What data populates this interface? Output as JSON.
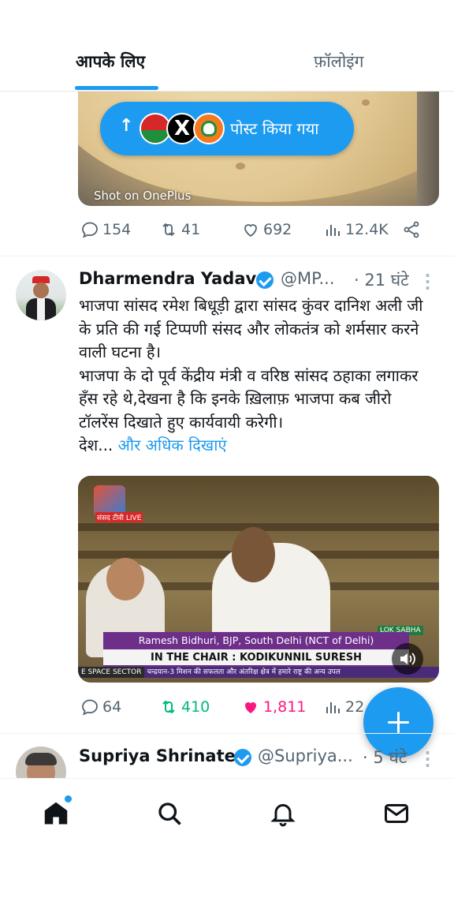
{
  "tabs": {
    "for_you": "आपके लिए",
    "following": "फ़ॉलोइंग"
  },
  "tweet1": {
    "media_caption": "Shot on OnePlus",
    "posted_pill": {
      "arrow": "↑",
      "label": "पोस्ट किया गया",
      "x_logo": "X"
    },
    "stats": {
      "replies": "154",
      "reposts": "41",
      "likes": "692",
      "views": "12.4K"
    }
  },
  "tweet2": {
    "name": "Dharmendra Yadav",
    "handle": "@MP...",
    "time": "· 21 घंटे",
    "text_p1": "भाजपा सांसद रमेश बिधूड़ी द्वारा सांसद कुंवर दानिश अली जी के प्रति की गई टिप्पणी संसद और लोकतंत्र को शर्मसार करने वाली घटना है।",
    "text_p2": "भाजपा के दो पूर्व केंद्रीय मंत्री व वरिष्ठ सांसद ठहाका लगाकर हँस रहे थे,देखना है कि इनके ख़िलाफ़ भाजपा कब जीरो टॉलरेंस दिखाते हुए कार्यवायी करेगी।",
    "text_p3_start": "देश...",
    "show_more": "और अधिक दिखाएं",
    "video": {
      "banner_line1": "Ramesh Bidhuri, BJP, South Delhi (NCT of Delhi)",
      "banner_line2": "IN THE CHAIR : KODIKUNNIL SURESH",
      "ticker_left": "E SPACE SECTOR",
      "ticker_text": "चन्द्रयान-3 मिशन की सफलता और अंतरिक्ष क्षेत्र में हमारे राष्ट्र की अन्य उपल",
      "channel_tag": "संसद टीवी LIVE",
      "lok_sabha_tag": "LOK SABHA"
    },
    "stats": {
      "replies": "64",
      "reposts": "410",
      "likes": "1,811",
      "views": "22"
    }
  },
  "tweet3": {
    "name": "Supriya Shrinate",
    "handle": "@Supriya...",
    "time": "· 5 घंटे"
  },
  "colors": {
    "accent": "#1d9bf0",
    "repost_active": "#00ba7c",
    "like_active": "#f91880",
    "muted_text": "#536471"
  },
  "icons": [
    "reply-icon",
    "repost-icon",
    "like-icon",
    "views-icon",
    "share-icon",
    "verified-icon",
    "more-icon",
    "home-icon",
    "search-icon",
    "notifications-icon",
    "messages-icon",
    "compose-icon",
    "mute-icon"
  ]
}
